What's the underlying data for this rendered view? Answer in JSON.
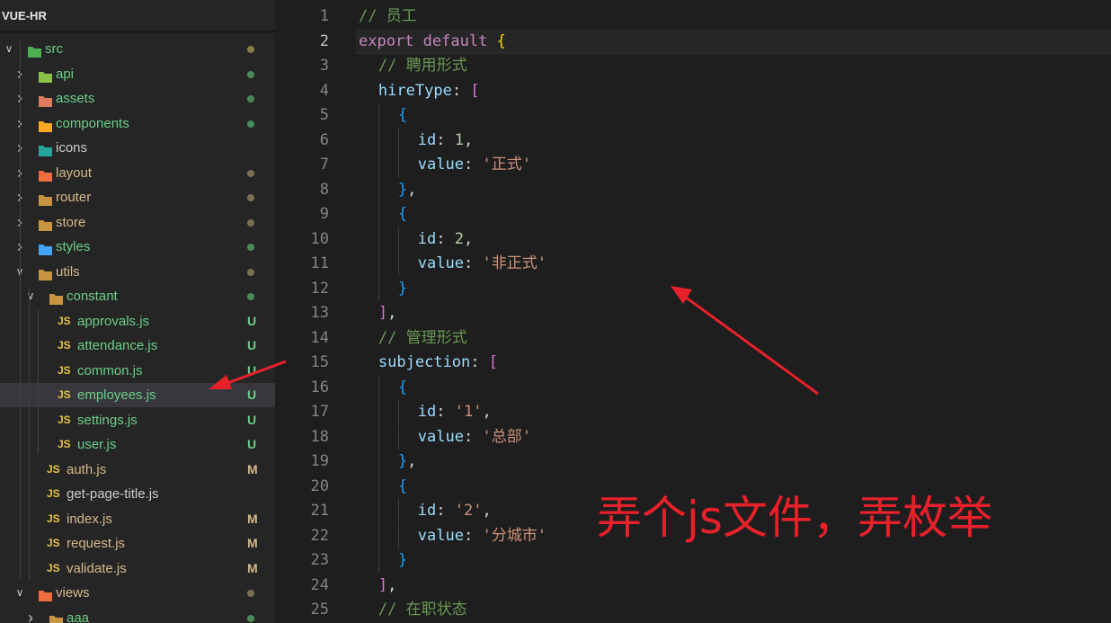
{
  "explorer": {
    "title": "VUE-HR",
    "rows": [
      {
        "kind": "folder",
        "depth": 0,
        "expanded": true,
        "label": "src",
        "color": "#6ccf86",
        "icon": "folder-src-icon",
        "iconColor": "#4caf50",
        "status": "dot",
        "statusColor": "#8a7d43"
      },
      {
        "kind": "folder",
        "depth": 1,
        "expanded": false,
        "label": "api",
        "color": "#6ccf86",
        "icon": "folder-api-icon",
        "iconColor": "#8bc34a",
        "status": "dot",
        "statusColor": "#4a8a58"
      },
      {
        "kind": "folder",
        "depth": 1,
        "expanded": false,
        "label": "assets",
        "color": "#6ccf86",
        "icon": "folder-assets-icon",
        "iconColor": "#e07a5f",
        "status": "dot",
        "statusColor": "#4a8a58"
      },
      {
        "kind": "folder",
        "depth": 1,
        "expanded": false,
        "label": "components",
        "color": "#6ccf86",
        "icon": "folder-components-icon",
        "iconColor": "#f9a825",
        "status": "dot",
        "statusColor": "#4a8a58"
      },
      {
        "kind": "folder",
        "depth": 1,
        "expanded": false,
        "label": "icons",
        "color": "#cccccc",
        "icon": "folder-icons-icon",
        "iconColor": "#26a69a",
        "status": "none",
        "statusColor": ""
      },
      {
        "kind": "folder",
        "depth": 1,
        "expanded": false,
        "label": "layout",
        "color": "#d7b98a",
        "icon": "folder-layout-icon",
        "iconColor": "#ef6c3f",
        "status": "dot",
        "statusColor": "#7b6f54"
      },
      {
        "kind": "folder",
        "depth": 1,
        "expanded": false,
        "label": "router",
        "color": "#d7b98a",
        "icon": "folder-router-icon",
        "iconColor": "#c7953f",
        "status": "dot",
        "statusColor": "#7b6f54"
      },
      {
        "kind": "folder",
        "depth": 1,
        "expanded": false,
        "label": "store",
        "color": "#d7b98a",
        "icon": "folder-store-icon",
        "iconColor": "#c7953f",
        "status": "dot",
        "statusColor": "#7b6f54"
      },
      {
        "kind": "folder",
        "depth": 1,
        "expanded": false,
        "label": "styles",
        "color": "#6ccf86",
        "icon": "folder-styles-icon",
        "iconColor": "#42a5f5",
        "status": "dot",
        "statusColor": "#4a8a58"
      },
      {
        "kind": "folder",
        "depth": 1,
        "expanded": true,
        "label": "utils",
        "color": "#d7b98a",
        "icon": "folder-utils-icon",
        "iconColor": "#c7953f",
        "status": "dot",
        "statusColor": "#7b6f54"
      },
      {
        "kind": "folder",
        "depth": 2,
        "expanded": true,
        "label": "constant",
        "color": "#6ccf86",
        "icon": "folder-constant-icon",
        "iconColor": "#c7953f",
        "status": "dot",
        "statusColor": "#4a8a58"
      },
      {
        "kind": "file",
        "depth": 3,
        "label": "approvals.js",
        "color": "#6ccf86",
        "status": "badge",
        "badge": "U",
        "statusColor": "#6ccf86"
      },
      {
        "kind": "file",
        "depth": 3,
        "label": "attendance.js",
        "color": "#6ccf86",
        "status": "badge",
        "badge": "U",
        "statusColor": "#6ccf86"
      },
      {
        "kind": "file",
        "depth": 3,
        "label": "common.js",
        "color": "#6ccf86",
        "status": "badge",
        "badge": "U",
        "statusColor": "#6ccf86"
      },
      {
        "kind": "file",
        "depth": 3,
        "label": "employees.js",
        "color": "#6ccf86",
        "status": "badge",
        "badge": "U",
        "statusColor": "#6ccf86",
        "selected": true
      },
      {
        "kind": "file",
        "depth": 3,
        "label": "settings.js",
        "color": "#6ccf86",
        "status": "badge",
        "badge": "U",
        "statusColor": "#6ccf86"
      },
      {
        "kind": "file",
        "depth": 3,
        "label": "user.js",
        "color": "#6ccf86",
        "status": "badge",
        "badge": "U",
        "statusColor": "#6ccf86"
      },
      {
        "kind": "file",
        "depth": 2,
        "label": "auth.js",
        "color": "#d7b98a",
        "status": "badge",
        "badge": "M",
        "statusColor": "#d7b98a"
      },
      {
        "kind": "file",
        "depth": 2,
        "label": "get-page-title.js",
        "color": "#cccccc",
        "status": "none",
        "statusColor": ""
      },
      {
        "kind": "file",
        "depth": 2,
        "label": "index.js",
        "color": "#d7b98a",
        "status": "badge",
        "badge": "M",
        "statusColor": "#d7b98a"
      },
      {
        "kind": "file",
        "depth": 2,
        "label": "request.js",
        "color": "#d7b98a",
        "status": "badge",
        "badge": "M",
        "statusColor": "#d7b98a"
      },
      {
        "kind": "file",
        "depth": 2,
        "label": "validate.js",
        "color": "#d7b98a",
        "status": "badge",
        "badge": "M",
        "statusColor": "#d7b98a"
      },
      {
        "kind": "folder",
        "depth": 1,
        "expanded": true,
        "label": "views",
        "color": "#d7b98a",
        "icon": "folder-views-icon",
        "iconColor": "#ef6c3f",
        "status": "dot",
        "statusColor": "#7b6f54"
      },
      {
        "kind": "folder",
        "depth": 2,
        "expanded": false,
        "label": "aaa",
        "color": "#6ccf86",
        "icon": "folder-aaa-icon",
        "iconColor": "#c7953f",
        "status": "dot",
        "statusColor": "#4a8a58"
      }
    ],
    "js_icon_label": "JS"
  },
  "editor": {
    "active_line": 2,
    "lines": [
      {
        "n": "1",
        "indent": 0,
        "tokens": [
          [
            "// 员工",
            "#6a9955"
          ]
        ]
      },
      {
        "n": "2",
        "indent": 0,
        "tokens": [
          [
            "export",
            "#c586c0"
          ],
          [
            " ",
            "#d4d4d4"
          ],
          [
            "default",
            "#c586c0"
          ],
          [
            " ",
            "#d4d4d4"
          ],
          [
            "{",
            "#ffd700"
          ]
        ]
      },
      {
        "n": "3",
        "indent": 1,
        "tokens": [
          [
            "// 聘用形式",
            "#6a9955"
          ]
        ]
      },
      {
        "n": "4",
        "indent": 1,
        "tokens": [
          [
            "hireType",
            "#9cdcfe"
          ],
          [
            ": ",
            "#d4d4d4"
          ],
          [
            "[",
            "#da70d6"
          ]
        ]
      },
      {
        "n": "5",
        "indent": 2,
        "tokens": [
          [
            "{",
            "#179fff"
          ]
        ]
      },
      {
        "n": "6",
        "indent": 3,
        "tokens": [
          [
            "id",
            "#9cdcfe"
          ],
          [
            ": ",
            "#d4d4d4"
          ],
          [
            "1",
            "#b5cea8"
          ],
          [
            ",",
            "#d4d4d4"
          ]
        ]
      },
      {
        "n": "7",
        "indent": 3,
        "tokens": [
          [
            "value",
            "#9cdcfe"
          ],
          [
            ": ",
            "#d4d4d4"
          ],
          [
            "'正式'",
            "#ce9178"
          ]
        ]
      },
      {
        "n": "8",
        "indent": 2,
        "tokens": [
          [
            "}",
            "#179fff"
          ],
          [
            ",",
            "#d4d4d4"
          ]
        ]
      },
      {
        "n": "9",
        "indent": 2,
        "tokens": [
          [
            "{",
            "#179fff"
          ]
        ]
      },
      {
        "n": "10",
        "indent": 3,
        "tokens": [
          [
            "id",
            "#9cdcfe"
          ],
          [
            ": ",
            "#d4d4d4"
          ],
          [
            "2",
            "#b5cea8"
          ],
          [
            ",",
            "#d4d4d4"
          ]
        ]
      },
      {
        "n": "11",
        "indent": 3,
        "tokens": [
          [
            "value",
            "#9cdcfe"
          ],
          [
            ": ",
            "#d4d4d4"
          ],
          [
            "'非正式'",
            "#ce9178"
          ]
        ]
      },
      {
        "n": "12",
        "indent": 2,
        "tokens": [
          [
            "}",
            "#179fff"
          ]
        ]
      },
      {
        "n": "13",
        "indent": 1,
        "tokens": [
          [
            "]",
            "#da70d6"
          ],
          [
            ",",
            "#d4d4d4"
          ]
        ]
      },
      {
        "n": "14",
        "indent": 1,
        "tokens": [
          [
            "// 管理形式",
            "#6a9955"
          ]
        ]
      },
      {
        "n": "15",
        "indent": 1,
        "tokens": [
          [
            "subjection",
            "#9cdcfe"
          ],
          [
            ": ",
            "#d4d4d4"
          ],
          [
            "[",
            "#da70d6"
          ]
        ]
      },
      {
        "n": "16",
        "indent": 2,
        "tokens": [
          [
            "{",
            "#179fff"
          ]
        ]
      },
      {
        "n": "17",
        "indent": 3,
        "tokens": [
          [
            "id",
            "#9cdcfe"
          ],
          [
            ": ",
            "#d4d4d4"
          ],
          [
            "'1'",
            "#ce9178"
          ],
          [
            ",",
            "#d4d4d4"
          ]
        ]
      },
      {
        "n": "18",
        "indent": 3,
        "tokens": [
          [
            "value",
            "#9cdcfe"
          ],
          [
            ": ",
            "#d4d4d4"
          ],
          [
            "'总部'",
            "#ce9178"
          ]
        ]
      },
      {
        "n": "19",
        "indent": 2,
        "tokens": [
          [
            "}",
            "#179fff"
          ],
          [
            ",",
            "#d4d4d4"
          ]
        ]
      },
      {
        "n": "20",
        "indent": 2,
        "tokens": [
          [
            "{",
            "#179fff"
          ]
        ]
      },
      {
        "n": "21",
        "indent": 3,
        "tokens": [
          [
            "id",
            "#9cdcfe"
          ],
          [
            ": ",
            "#d4d4d4"
          ],
          [
            "'2'",
            "#ce9178"
          ],
          [
            ",",
            "#d4d4d4"
          ]
        ]
      },
      {
        "n": "22",
        "indent": 3,
        "tokens": [
          [
            "value",
            "#9cdcfe"
          ],
          [
            ": ",
            "#d4d4d4"
          ],
          [
            "'分城市'",
            "#ce9178"
          ]
        ]
      },
      {
        "n": "23",
        "indent": 2,
        "tokens": [
          [
            "}",
            "#179fff"
          ]
        ]
      },
      {
        "n": "24",
        "indent": 1,
        "tokens": [
          [
            "]",
            "#da70d6"
          ],
          [
            ",",
            "#d4d4d4"
          ]
        ]
      },
      {
        "n": "25",
        "indent": 1,
        "tokens": [
          [
            "// 在职状态",
            "#6a9955"
          ]
        ]
      }
    ]
  },
  "annotation": {
    "text": "弄个js文件，弄枚举",
    "color": "#e8202a"
  }
}
